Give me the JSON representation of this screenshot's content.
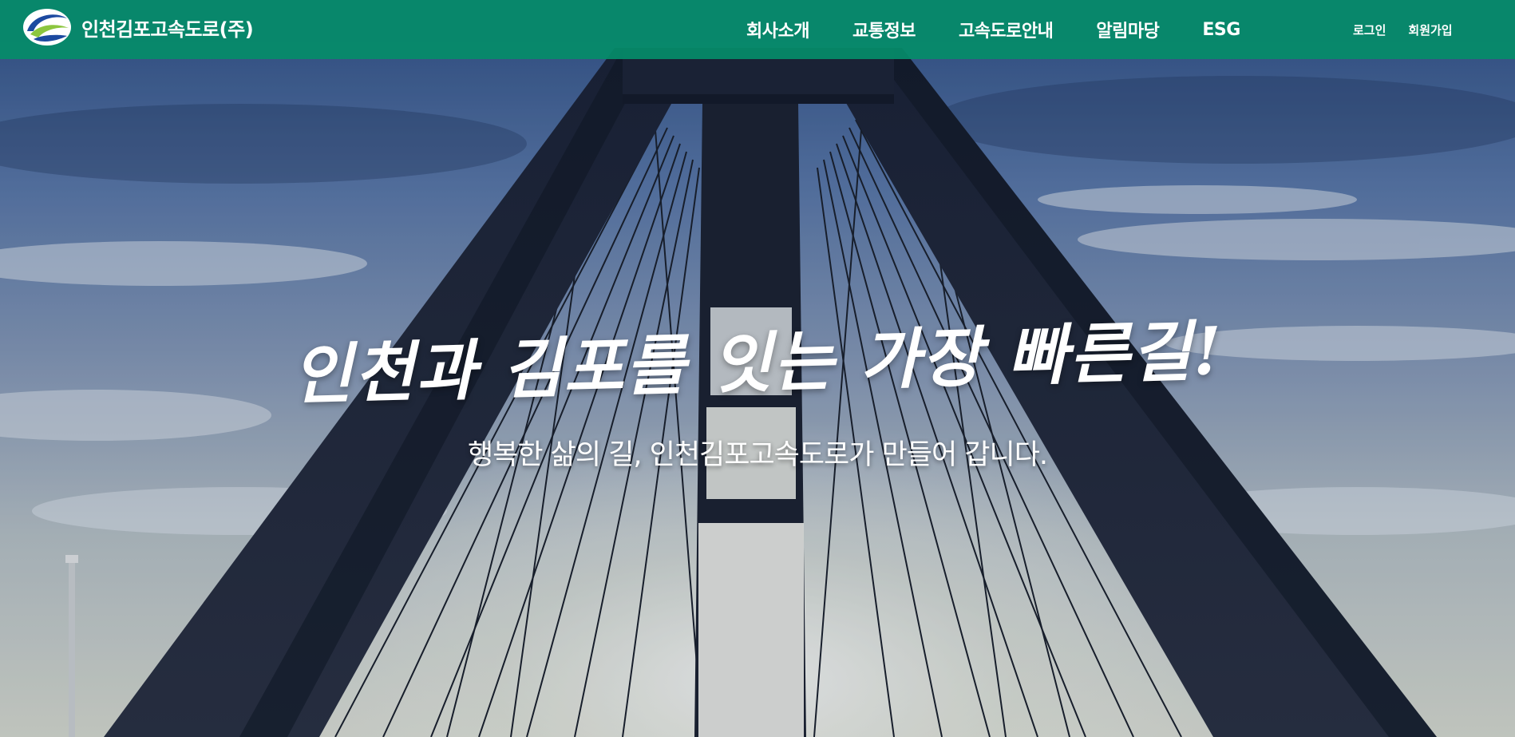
{
  "header": {
    "brand_name": "인천김포고속도로(주)",
    "background_color": "#058c69",
    "nav": [
      {
        "label": "회사소개"
      },
      {
        "label": "교통정보"
      },
      {
        "label": "고속도로안내"
      },
      {
        "label": "알림마당"
      },
      {
        "label": "ESG"
      }
    ],
    "util": {
      "login_label": "로그인",
      "signup_label": "회원가입"
    }
  },
  "hero": {
    "headline": "인천과 김포를 잇는 가장 빠른길!",
    "subline": "행복한 삶의 길, 인천김포고속도로가 만들어 갑니다."
  },
  "icons": {
    "logo": "brand-logo-icon"
  }
}
